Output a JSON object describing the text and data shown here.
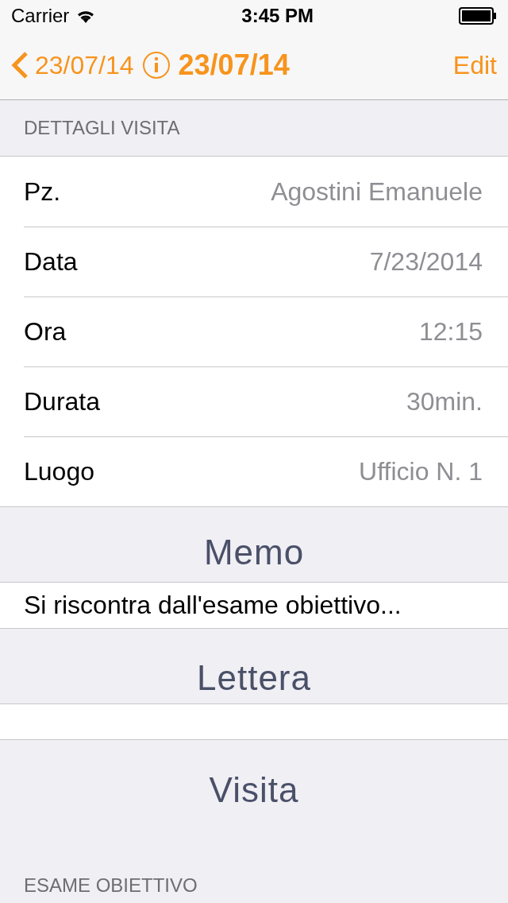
{
  "status_bar": {
    "carrier": "Carrier",
    "time": "3:45 PM"
  },
  "nav": {
    "back": "23/07/14",
    "title": "23/07/14",
    "edit": "Edit"
  },
  "details": {
    "header": "DETTAGLI VISITA",
    "rows": [
      {
        "label": "Pz.",
        "value": "Agostini Emanuele"
      },
      {
        "label": "Data",
        "value": "7/23/2014"
      },
      {
        "label": "Ora",
        "value": "12:15"
      },
      {
        "label": "Durata",
        "value": "30min."
      },
      {
        "label": "Luogo",
        "value": "Ufficio N. 1"
      }
    ]
  },
  "memo": {
    "title": "Memo",
    "text": "Si riscontra dall'esame obiettivo..."
  },
  "lettera": {
    "title": "Lettera"
  },
  "visita": {
    "title": "Visita",
    "header": "ESAME OBIETTIVO"
  }
}
